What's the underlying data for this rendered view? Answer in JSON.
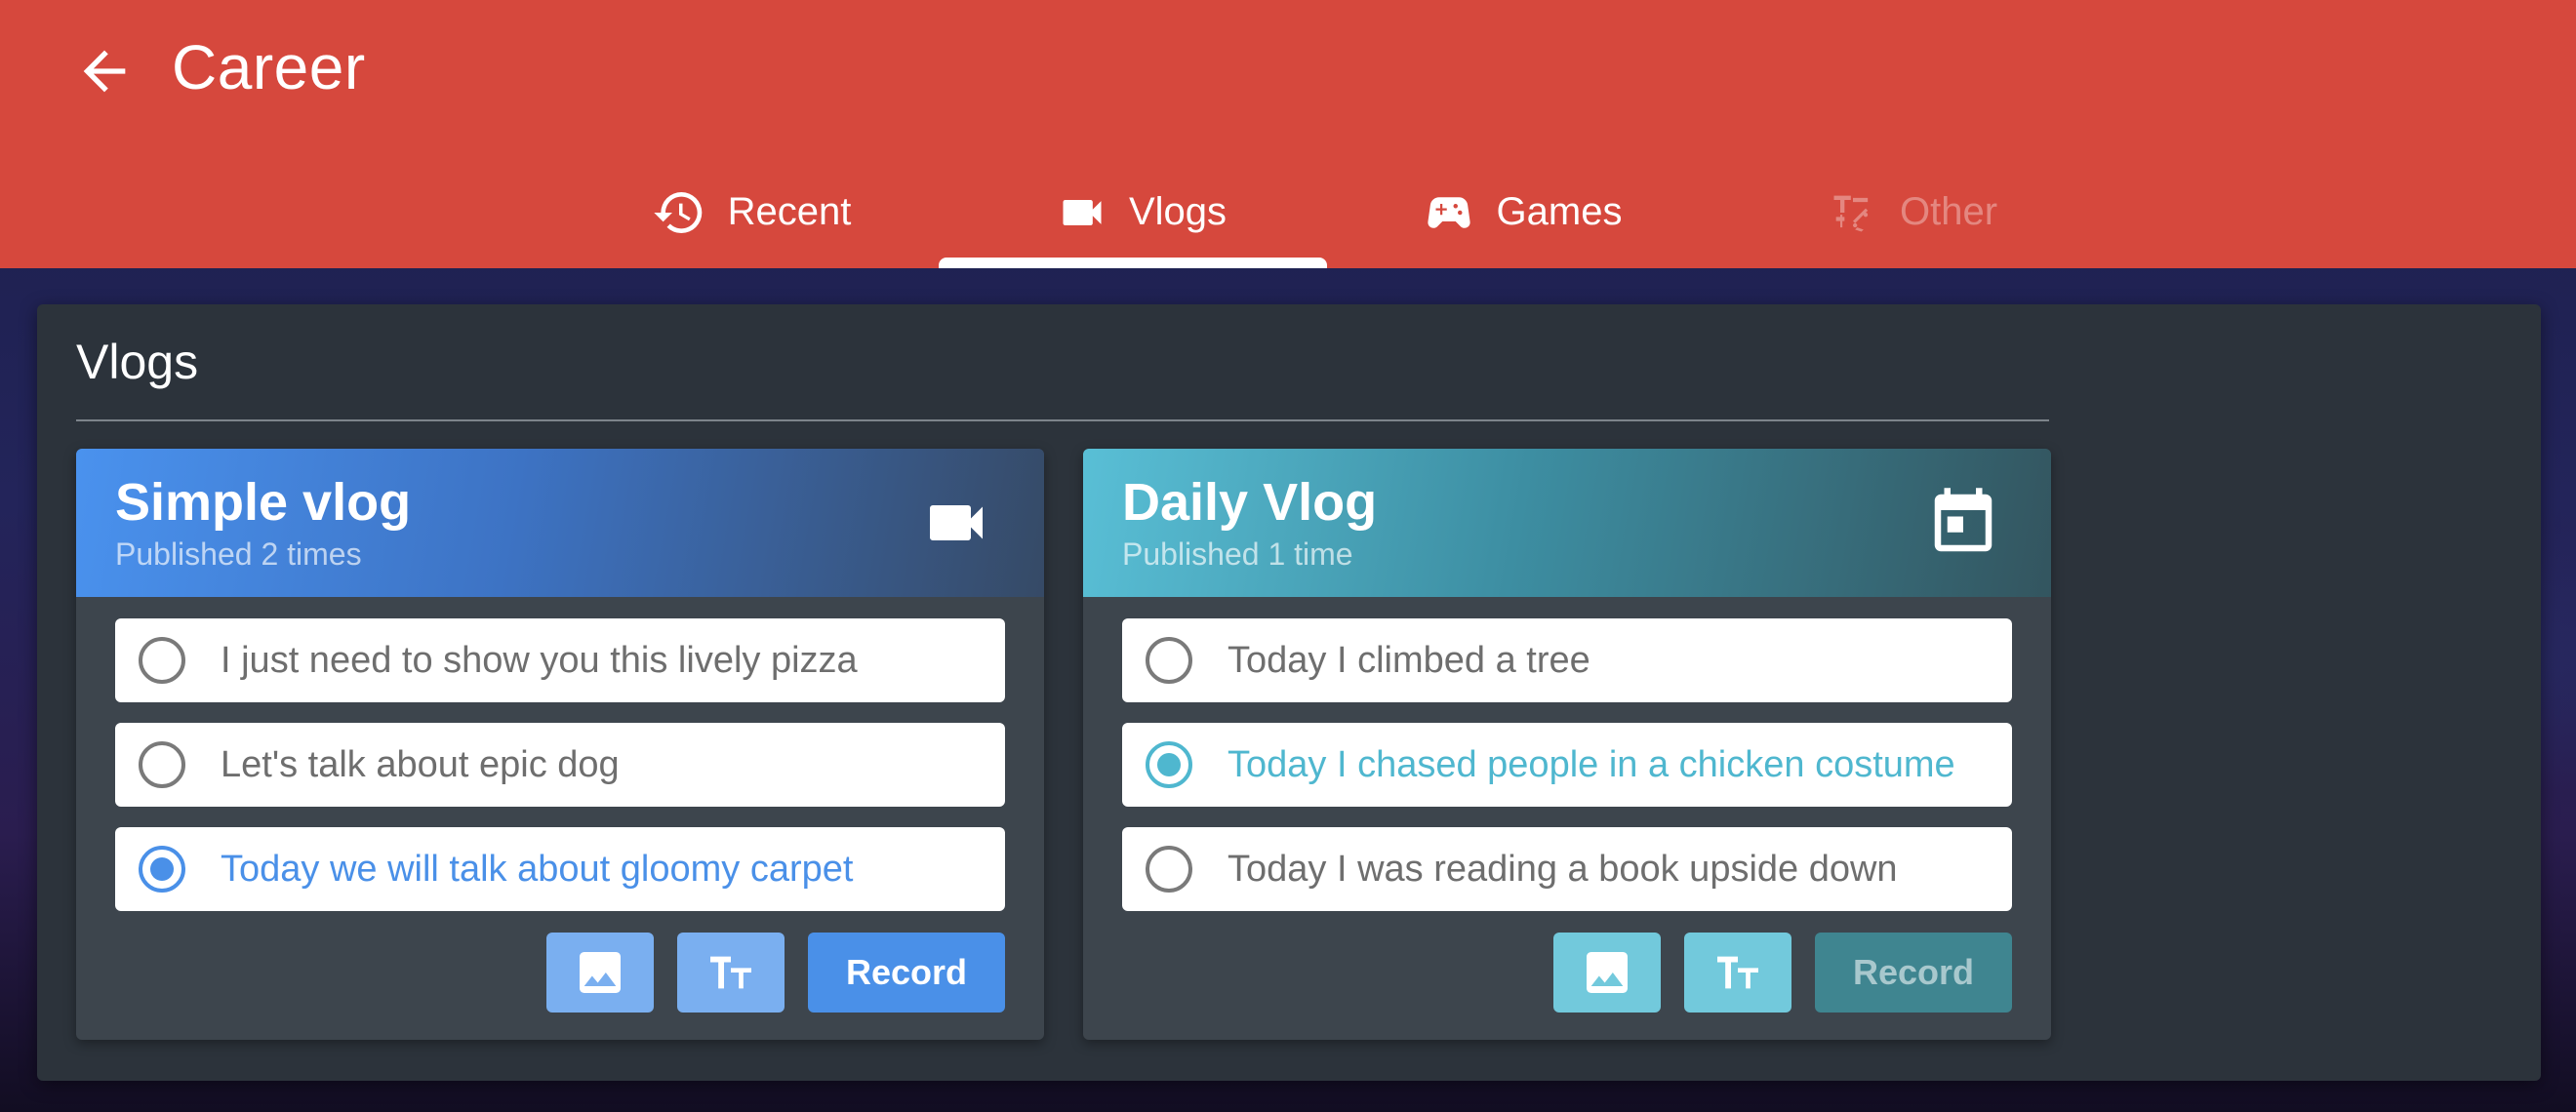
{
  "header": {
    "title": "Career",
    "background_color": "#d6483d"
  },
  "tabs": [
    {
      "label": "Recent",
      "icon": "history-icon",
      "active": false,
      "disabled": false
    },
    {
      "label": "Vlogs",
      "icon": "videocam-icon",
      "active": true,
      "disabled": false
    },
    {
      "label": "Games",
      "icon": "gamepad-icon",
      "active": false,
      "disabled": false
    },
    {
      "label": "Other",
      "icon": "symbols-icon",
      "active": false,
      "disabled": true
    }
  ],
  "section": {
    "title": "Vlogs"
  },
  "cards": [
    {
      "title": "Simple vlog",
      "subtitle": "Published 2 times",
      "icon": "videocam-icon",
      "accent": "#4a90e8",
      "options": [
        {
          "label": "I just need to show you this lively pizza",
          "selected": false
        },
        {
          "label": "Let's talk about epic dog",
          "selected": false
        },
        {
          "label": "Today we will talk about gloomy carpet",
          "selected": true
        }
      ],
      "actions": {
        "image_icon": "image-icon",
        "text_icon": "text-size-icon",
        "record_label": "Record"
      }
    },
    {
      "title": "Daily Vlog",
      "subtitle": "Published 1 time",
      "icon": "calendar-icon",
      "accent": "#4fb7cf",
      "options": [
        {
          "label": "Today I climbed a tree",
          "selected": false
        },
        {
          "label": "Today I chased people in a chicken costume",
          "selected": true
        },
        {
          "label": "Today I was reading a book upside down",
          "selected": false
        }
      ],
      "actions": {
        "image_icon": "image-icon",
        "text_icon": "text-size-icon",
        "record_label": "Record",
        "record_disabled": true
      }
    }
  ]
}
